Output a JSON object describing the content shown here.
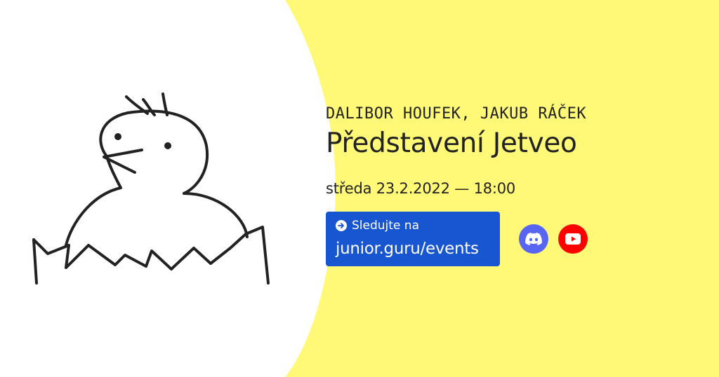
{
  "event": {
    "speakers": "DALIBOR HOUFEK, JAKUB RÁČEK",
    "title": "Představení Jetveo",
    "date": "středa 23.2.2022 — 18:00"
  },
  "cta": {
    "label": "Sledujte na",
    "url_text": "junior.guru/events"
  },
  "social": {
    "discord_icon": "discord-icon",
    "youtube_icon": "youtube-icon"
  },
  "colors": {
    "background_yellow": "#fff977",
    "cta_blue": "#1755d1",
    "discord": "#5865f2",
    "youtube": "#ff0000",
    "text": "#222222"
  }
}
